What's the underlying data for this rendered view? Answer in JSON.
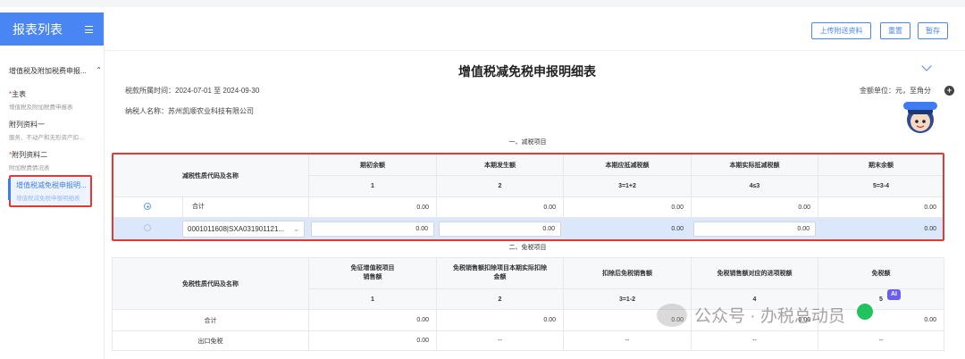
{
  "sidebar": {
    "title": "报表列表",
    "menu_icon": "hamburger-icon",
    "group_title": "增值税及附加税费申报...",
    "items": [
      {
        "title": "主表",
        "subtitle": "增值税及附加税费申报表",
        "required": "*"
      },
      {
        "title": "附列资料一",
        "subtitle": "服务、不动产和无形资产扣...",
        "required": ""
      },
      {
        "title": "附列资料二",
        "subtitle": "附加税费情况表",
        "required": "*"
      }
    ],
    "active_item": {
      "title": "增值税减免税申报明...",
      "subtitle": "增值税减免税申报明细表"
    }
  },
  "toolbar": {
    "upload_label": "上传附送资料",
    "reset_label": "重置",
    "save_label": "暂存"
  },
  "form": {
    "title": "增值税减免税申报明细表",
    "period": "税款所属时间：2024-07-01 至 2024-09-30",
    "taxpayer": "纳税人名称：苏州凯顺农业科技有限公司",
    "unit": "金额单位：元，至角分"
  },
  "section1": {
    "title": "一、减税项目",
    "headers": [
      "减税性质代码及名称",
      "期初余额",
      "本期发生额",
      "本期应抵减税额",
      "本期实际抵减税额",
      "期末余额"
    ],
    "col_nums": [
      "1",
      "2",
      "3=1+2",
      "4≤3",
      "5=3-4"
    ],
    "total_row": {
      "label": "合计",
      "values": [
        "0.00",
        "0.00",
        "0.00",
        "0.00",
        "0.00"
      ]
    },
    "entry_row": {
      "code": "0001011608|SXA031901121...",
      "values": [
        "0.00",
        "0.00",
        "0.00",
        "0.00",
        "0.00"
      ]
    }
  },
  "section2": {
    "title": "二、免税项目",
    "headers": [
      "免税性质代码及名称",
      "免征增值税项目\n销售额",
      "免税销售额扣除项目本期实际扣除\n金额",
      "扣除后免税销售额",
      "免税销售额对应的进项税额",
      "免税额"
    ],
    "col_nums": [
      "1",
      "2",
      "3=1-2",
      "4",
      "5"
    ],
    "total_row": {
      "label": "合计",
      "values": [
        "0.00",
        "0.00",
        "0.00",
        "0.00",
        "0.00"
      ]
    },
    "export_row": {
      "label": "出口免税",
      "values": [
        "0.00",
        "--",
        "--",
        "--",
        "--"
      ]
    }
  },
  "watermark": {
    "text": "公众号 · 办税总动员",
    "ai_badge": "AI"
  }
}
